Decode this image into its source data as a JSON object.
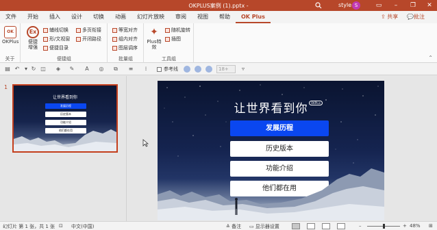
{
  "window": {
    "title": "OKPLUS案例 (1).pptx  -",
    "user": "style",
    "avatar_letter": "S",
    "minimize": "–",
    "restore": "❐",
    "close": "✕",
    "accent_color": "#b7472a"
  },
  "ribbon_tabs": [
    "文件",
    "开始",
    "插入",
    "设计",
    "切换",
    "动画",
    "幻灯片放映",
    "审阅",
    "视图",
    "帮助",
    "OK Plus"
  ],
  "active_tab": "OK Plus",
  "share_label": "共享",
  "comment_label": "批注",
  "ribbon": {
    "about": {
      "button": "OKPlus",
      "group": "关于"
    },
    "convenience": {
      "big_button": "便捷\n增强",
      "items": [
        "辅线切换",
        "形/文视窗",
        "便捷目录",
        "多页衔接",
        "开闭路径"
      ],
      "group": "便捷组"
    },
    "batch": {
      "items": [
        "等宽对齐",
        "组内对齐",
        "图层调序"
      ],
      "group": "批量组"
    },
    "tools": {
      "big_button": "Plus特\n效",
      "items": [
        "随机旋转",
        "插图"
      ],
      "group": "工具组"
    }
  },
  "toolbar": {
    "aux_line_label": "参考线",
    "font_size_value": "18+"
  },
  "thumbnail": {
    "number": "1",
    "title": "让世界看到你",
    "buttons": [
      "发展历程",
      "历史版本",
      "功能介绍",
      "他们都在用"
    ]
  },
  "slide": {
    "title": "让世界看到你",
    "badge": "OKPlus",
    "buttons": [
      {
        "label": "发展历程",
        "primary": true
      },
      {
        "label": "历史版本",
        "primary": false
      },
      {
        "label": "功能介绍",
        "primary": false
      },
      {
        "label": "他们都在用",
        "primary": false
      }
    ],
    "primary_color": "#0a47f0"
  },
  "statusbar": {
    "slide_info": "幻灯片 第 1 张，共 1 张",
    "language": "中文(中国)",
    "notes": "备注",
    "display_settings": "显示器设置",
    "zoom": "48%",
    "zoom_level": 0.48
  }
}
